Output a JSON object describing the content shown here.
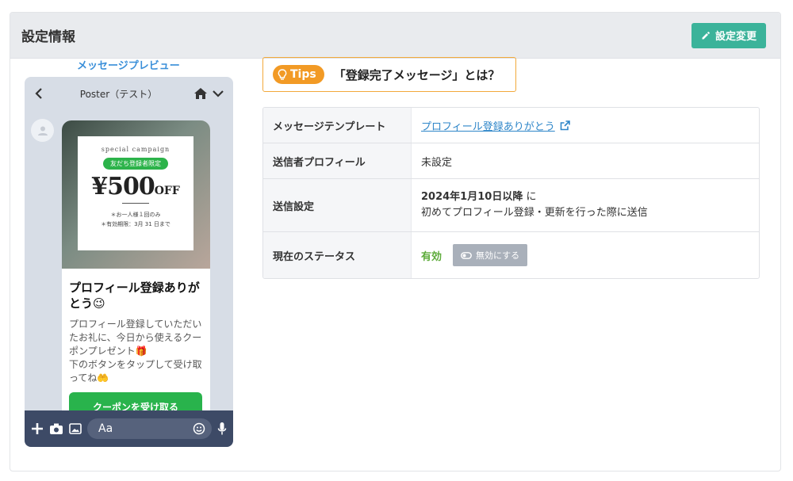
{
  "header": {
    "title": "設定情報",
    "edit_label": "設定変更"
  },
  "preview": {
    "label": "メッセージプレビュー",
    "chat_title": "Poster（テスト）",
    "coupon": {
      "campaign": "special campaign",
      "tag": "友だち登録者限定",
      "price": "¥500",
      "off": "OFF",
      "note1": "＊お一人様１回のみ",
      "note2": "＊有効期限：3月 31 日まで"
    },
    "bubble_title": "プロフィール登録ありがとう😉",
    "bubble_text": "プロフィール登録していただいたお礼に、今日から使えるクーポンプレゼント🎁\n下のボタンをタップして受け取ってね🤲",
    "button_label": "クーポンを受け取る",
    "input_placeholder": "Aa"
  },
  "tips": {
    "badge": "Tips",
    "text": "「登録完了メッセージ」とは？"
  },
  "table": {
    "template_key": "メッセージテンプレート",
    "template_value": "プロフィール登録ありがとう",
    "sender_key": "送信者プロフィール",
    "sender_value": "未設定",
    "send_key": "送信設定",
    "send_date": "2024年1月10日以降",
    "send_ni": " に",
    "send_line2": "初めてプロフィール登録・更新を行った際に送信",
    "status_key": "現在のステータス",
    "status_value": "有効",
    "disable_label": "無効にする"
  },
  "colors": {
    "accent": "#3bb39a",
    "link": "#2e86c9",
    "tips": "#f29a25",
    "line_green": "#29b34c"
  }
}
